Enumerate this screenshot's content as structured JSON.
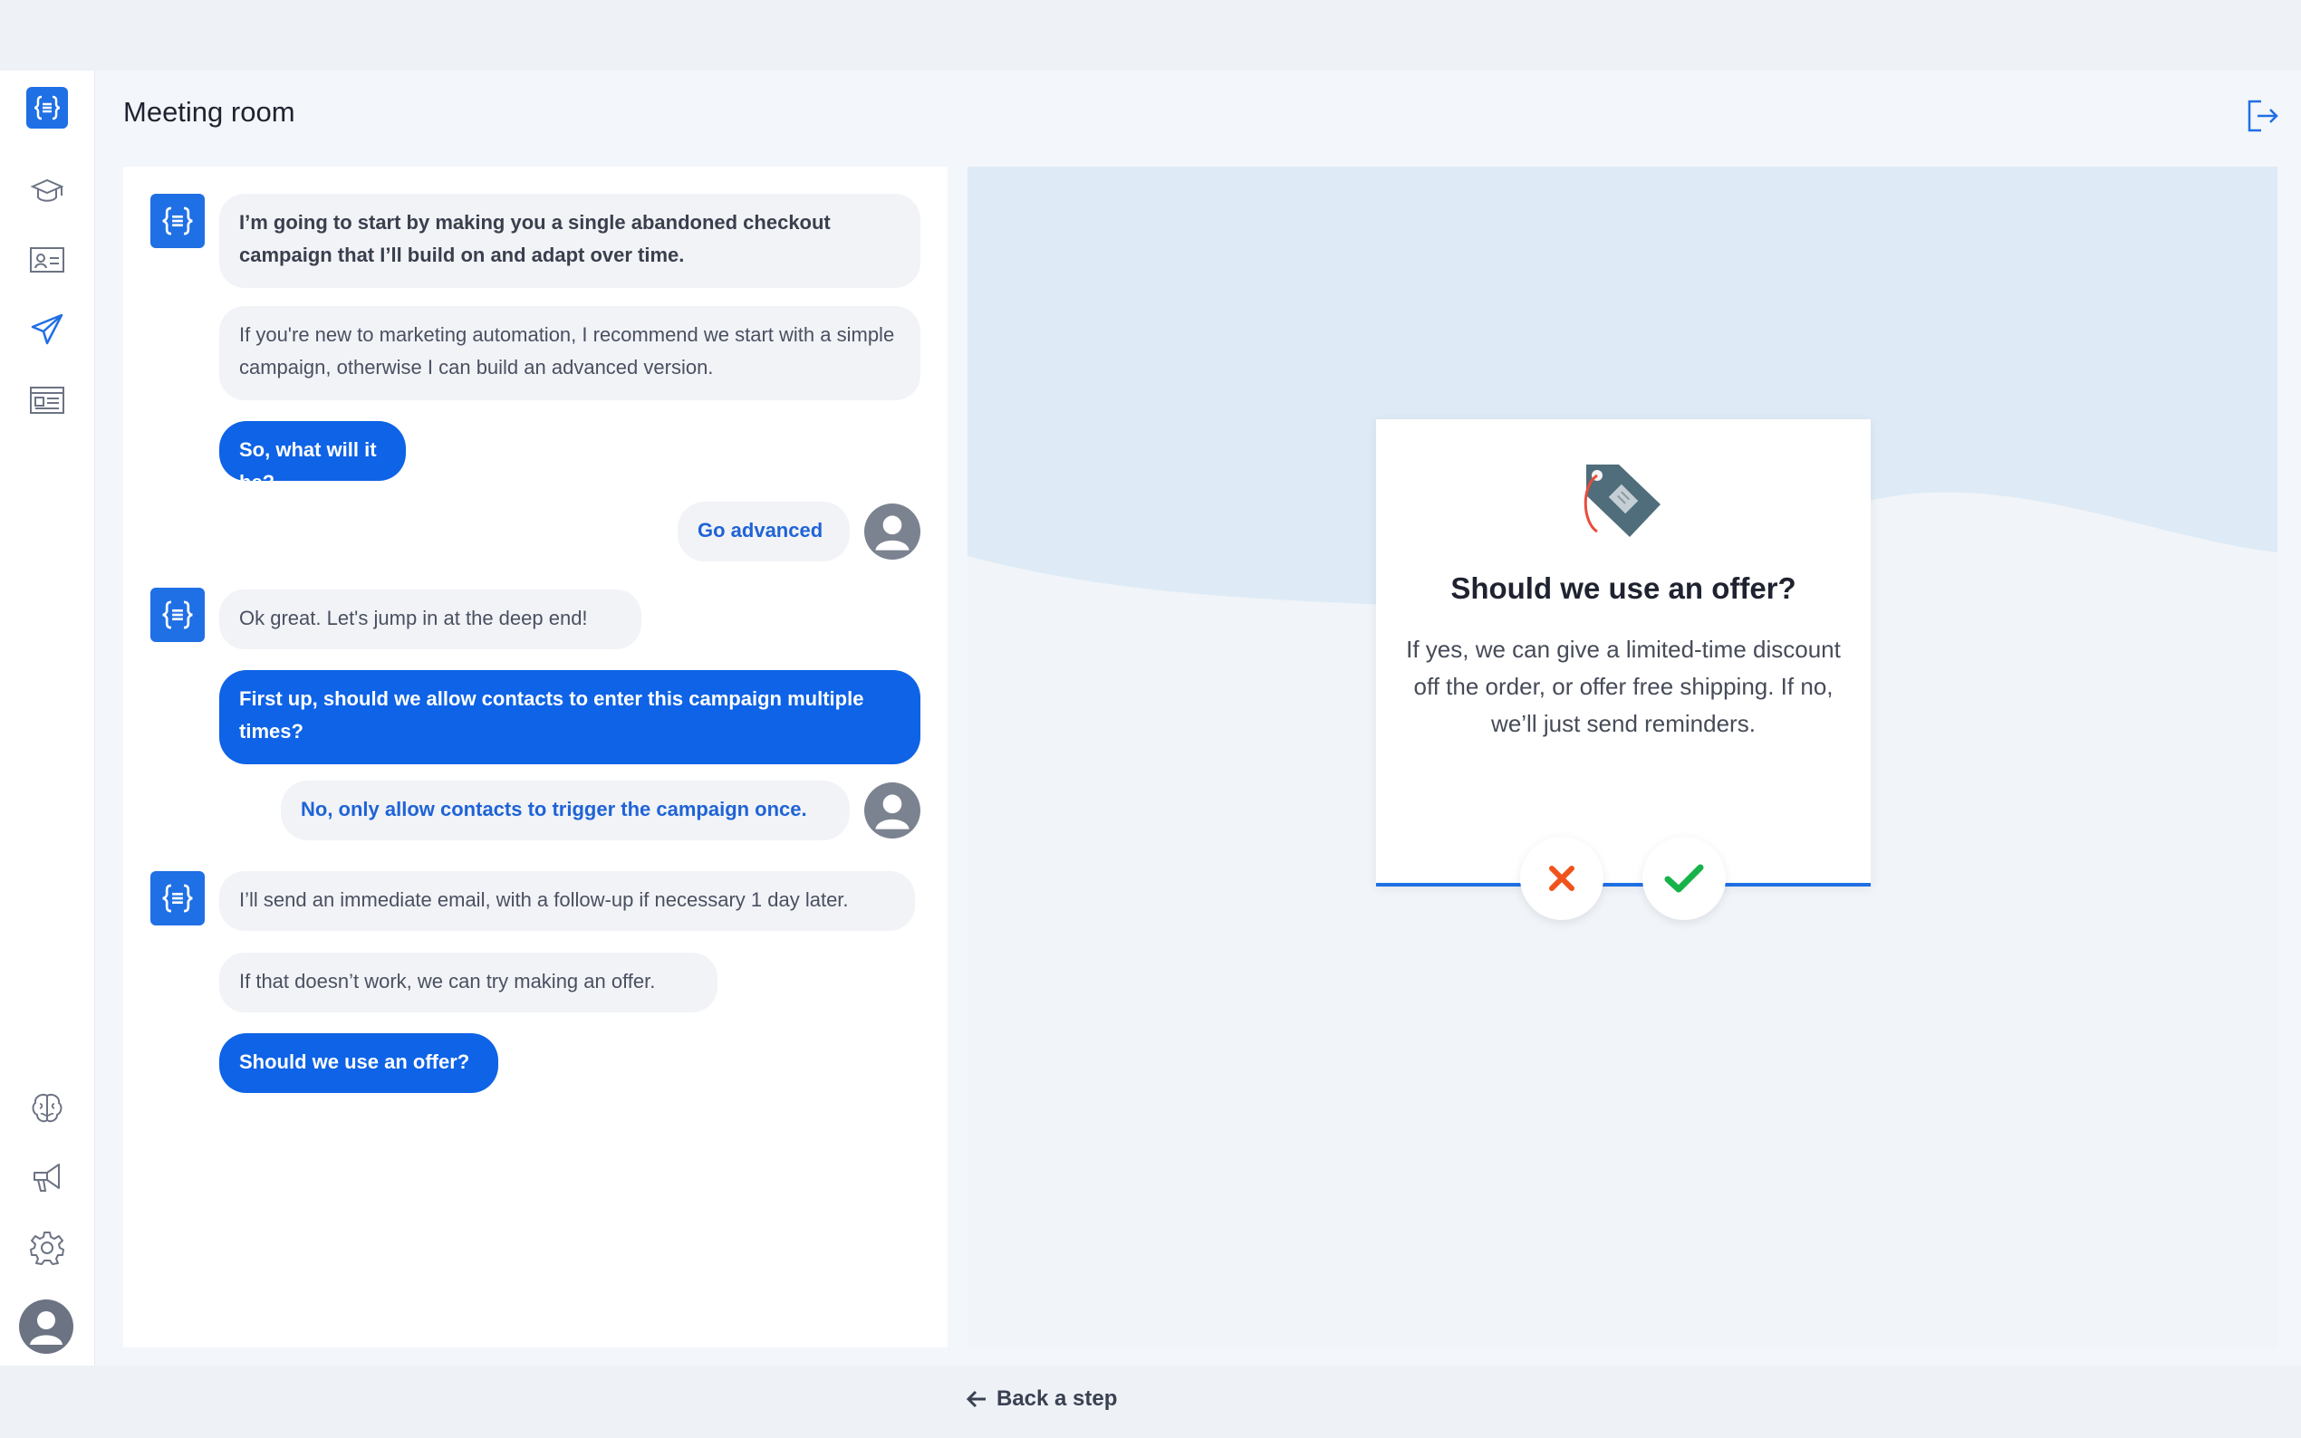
{
  "header": {
    "title": "Meeting room"
  },
  "sidebar": {
    "items": [
      {
        "icon": "graduation-cap-icon"
      },
      {
        "icon": "contact-card-icon"
      },
      {
        "icon": "paper-plane-icon"
      },
      {
        "icon": "newsletter-icon"
      },
      {
        "icon": "brain-icon"
      },
      {
        "icon": "megaphone-icon"
      },
      {
        "icon": "gear-icon"
      }
    ]
  },
  "chat": {
    "messages": [
      {
        "text": "I’m going to start by making you a single abandoned checkout campaign that I’ll build on and adapt over time."
      },
      {
        "text": "If you're new to marketing automation, I recommend we start with a simple campaign, otherwise I can build an advanced version."
      },
      {
        "text": "So, what will it be?"
      },
      {
        "text": "Go advanced"
      },
      {
        "text": "Ok great. Let's jump in at the deep end!"
      },
      {
        "text": "First up, should we allow contacts to enter this campaign multiple times?"
      },
      {
        "text": "No, only allow contacts to trigger the campaign once."
      },
      {
        "text": "I’ll send an immediate email, with a follow-up if necessary 1 day later."
      },
      {
        "text": "If that doesn’t work, we can try making an offer."
      },
      {
        "text": "Should we use an offer?"
      }
    ]
  },
  "offer_card": {
    "title": "Should we use an offer?",
    "body": "If yes, we can give a limited-time discount off the order, or offer free shipping. If no, we’ll just send reminders.",
    "icon": "price-tag-icon"
  },
  "actions": {
    "decline_icon": "x-icon",
    "accept_icon": "check-icon"
  },
  "navigation": {
    "back_label": "Back a step"
  },
  "colors": {
    "accent": "#0e63e6",
    "decline": "#f0531c",
    "accept": "#17b34a"
  }
}
